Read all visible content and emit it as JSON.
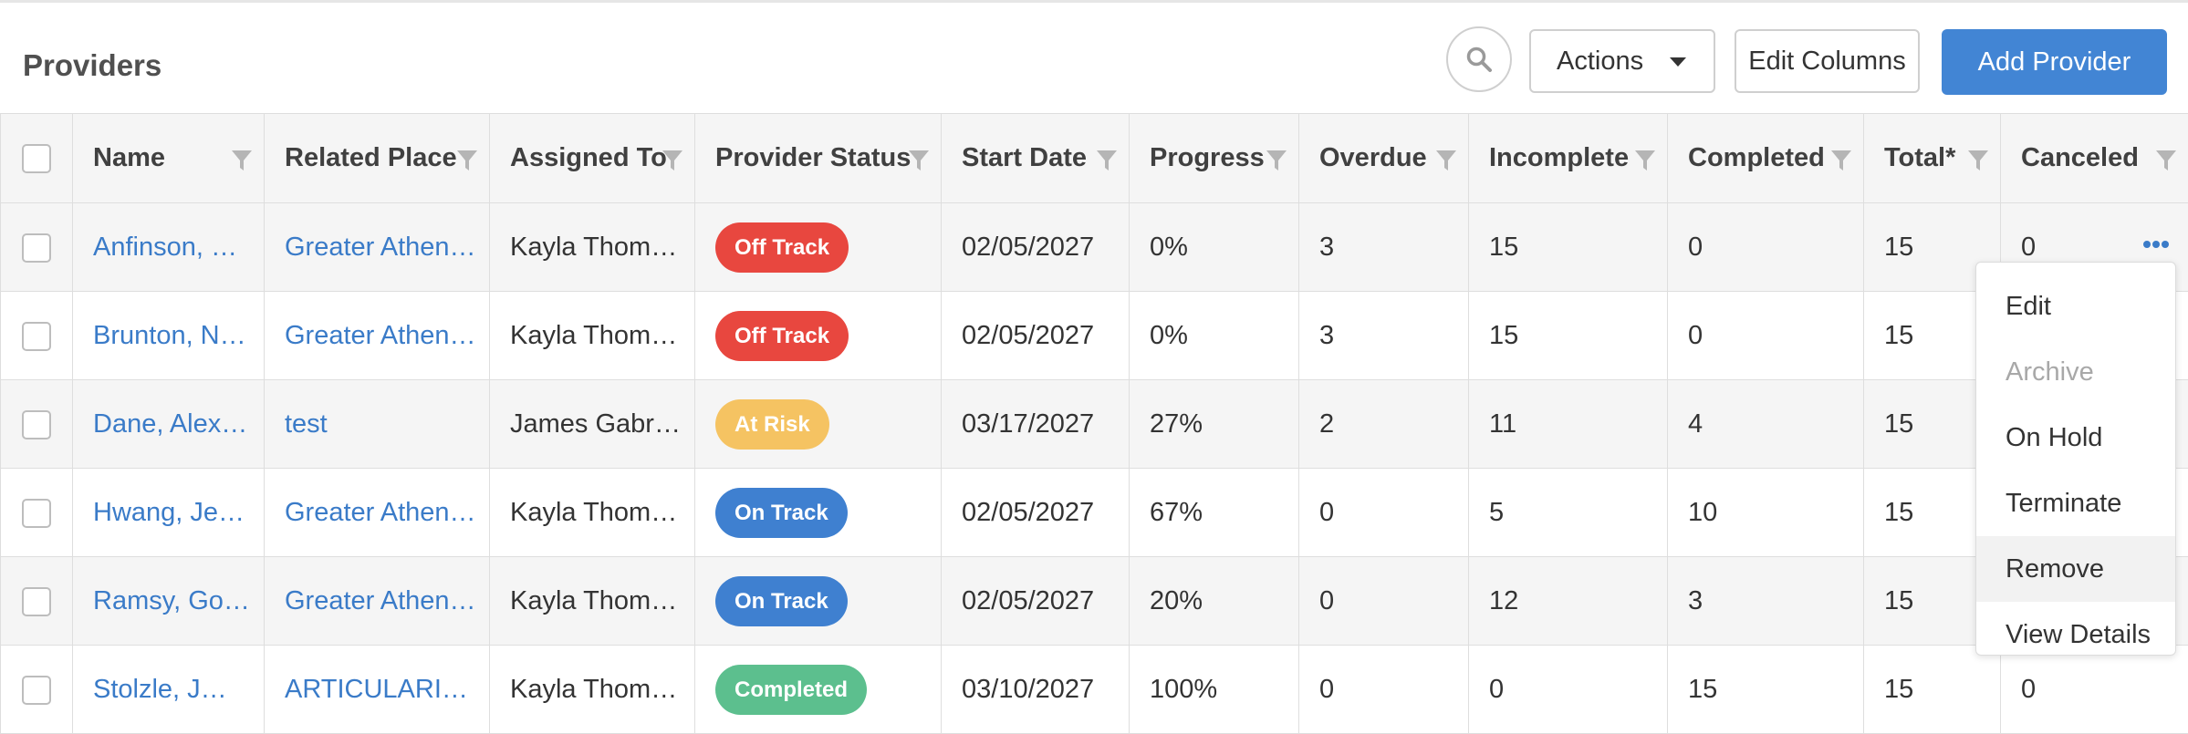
{
  "header": {
    "title": "Providers",
    "actions_label": "Actions",
    "edit_columns_label": "Edit Columns",
    "add_label": "Add Provider"
  },
  "columns": [
    "Name",
    "Related Place",
    "Assigned To",
    "Provider Status",
    "Start Date",
    "Progress",
    "Overdue",
    "Incomplete",
    "Completed",
    "Total*",
    "Canceled"
  ],
  "rows": [
    {
      "name": "Anfinson, S…",
      "place": "Greater Athen…",
      "assigned": "Kayla Thom…",
      "status": "Off Track",
      "status_color": "#e8473f",
      "start": "02/05/2027",
      "progress": "0%",
      "overdue": "3",
      "incomplete": "15",
      "completed": "0",
      "total": "15",
      "canceled": "0"
    },
    {
      "name": "Brunton, Ni…",
      "place": "Greater Athen…",
      "assigned": "Kayla Thom…",
      "status": "Off Track",
      "status_color": "#e8473f",
      "start": "02/05/2027",
      "progress": "0%",
      "overdue": "3",
      "incomplete": "15",
      "completed": "0",
      "total": "15",
      "canceled": ""
    },
    {
      "name": "Dane, Alex…",
      "place": "test",
      "assigned": "James Gabri…",
      "status": "At Risk",
      "status_color": "#f5c362",
      "start": "03/17/2027",
      "progress": "27%",
      "overdue": "2",
      "incomplete": "11",
      "completed": "4",
      "total": "15",
      "canceled": ""
    },
    {
      "name": "Hwang, Jen…",
      "place": "Greater Athen…",
      "assigned": "Kayla Thom…",
      "status": "On Track",
      "status_color": "#3f80d0",
      "start": "02/05/2027",
      "progress": "67%",
      "overdue": "0",
      "incomplete": "5",
      "completed": "10",
      "total": "15",
      "canceled": ""
    },
    {
      "name": "Ramsy, Gor…",
      "place": "Greater Athen…",
      "assigned": "Kayla Thom…",
      "status": "On Track",
      "status_color": "#3f80d0",
      "start": "02/05/2027",
      "progress": "20%",
      "overdue": "0",
      "incomplete": "12",
      "completed": "3",
      "total": "15",
      "canceled": ""
    },
    {
      "name": "Stolzle, J…",
      "place": "ARTICULARIS…",
      "assigned": "Kayla Thom…",
      "status": "Completed",
      "status_color": "#5cbf8e",
      "start": "03/10/2027",
      "progress": "100%",
      "overdue": "0",
      "incomplete": "0",
      "completed": "15",
      "total": "15",
      "canceled": "0"
    }
  ],
  "context_menu": {
    "items": [
      {
        "label": "Edit",
        "disabled": false
      },
      {
        "label": "Archive",
        "disabled": true
      },
      {
        "label": "On Hold",
        "disabled": false
      },
      {
        "label": "Terminate",
        "disabled": false
      },
      {
        "label": "Remove",
        "disabled": false,
        "hovered": true
      },
      {
        "label": "View Details",
        "disabled": false
      }
    ]
  },
  "colors": {
    "accent": "#4285d4",
    "link": "#3a7bc8",
    "off_track": "#e8473f",
    "at_risk": "#f5c362",
    "on_track": "#3f80d0",
    "completed": "#5cbf8e"
  }
}
